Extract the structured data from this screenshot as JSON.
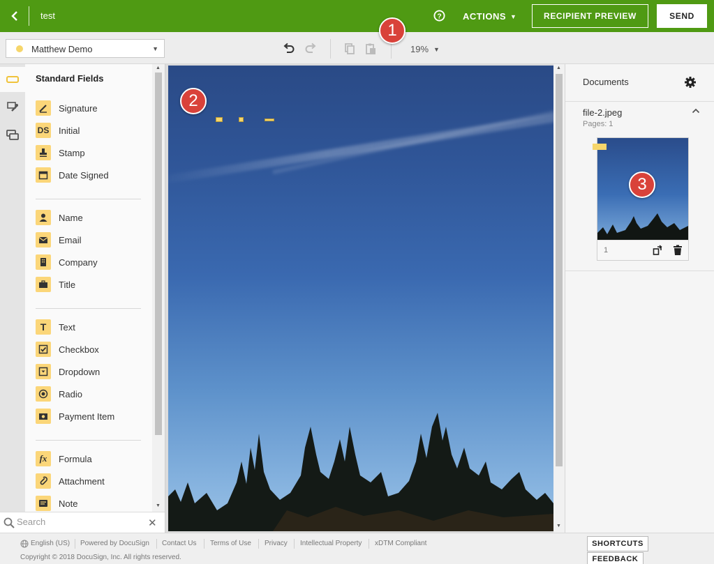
{
  "header": {
    "doc_title": "test",
    "actions_label": "ACTIONS",
    "preview_label": "RECIPIENT PREVIEW",
    "send_label": "SEND",
    "background_color": "#4f9a13"
  },
  "toolbar": {
    "recipient": "Matthew Demo",
    "recipient_color": "#f6d66b",
    "zoom": "19%"
  },
  "fields_panel": {
    "title": "Standard Fields",
    "groups": [
      [
        {
          "label": "Signature",
          "icon": "signature-icon"
        },
        {
          "label": "Initial",
          "icon": "initial-icon",
          "glyph": "DS"
        },
        {
          "label": "Stamp",
          "icon": "stamp-icon"
        },
        {
          "label": "Date Signed",
          "icon": "calendar-icon"
        }
      ],
      [
        {
          "label": "Name",
          "icon": "person-icon"
        },
        {
          "label": "Email",
          "icon": "envelope-icon"
        },
        {
          "label": "Company",
          "icon": "building-icon"
        },
        {
          "label": "Title",
          "icon": "briefcase-icon"
        }
      ],
      [
        {
          "label": "Text",
          "icon": "text-icon",
          "glyph": "T"
        },
        {
          "label": "Checkbox",
          "icon": "checkbox-icon"
        },
        {
          "label": "Dropdown",
          "icon": "dropdown-icon"
        },
        {
          "label": "Radio",
          "icon": "radio-icon"
        },
        {
          "label": "Payment Item",
          "icon": "payment-icon"
        }
      ],
      [
        {
          "label": "Formula",
          "icon": "formula-icon",
          "glyph": "fx"
        },
        {
          "label": "Attachment",
          "icon": "paperclip-icon"
        },
        {
          "label": "Note",
          "icon": "note-icon"
        }
      ]
    ],
    "search_placeholder": "Search"
  },
  "documents_panel": {
    "title": "Documents",
    "file_name": "file-2.jpeg",
    "pages_label": "Pages: 1",
    "page_number": "1"
  },
  "annotations": [
    "1",
    "2",
    "3"
  ],
  "footer": {
    "language": "English (US)",
    "links": [
      "Powered by DocuSign",
      "Contact Us",
      "Terms of Use",
      "Privacy",
      "Intellectual Property",
      "xDTM Compliant"
    ],
    "copyright": "Copyright © 2018 DocuSign, Inc. All rights reserved.",
    "shortcuts_label": "SHORTCUTS",
    "feedback_label": "FEEDBACK"
  }
}
